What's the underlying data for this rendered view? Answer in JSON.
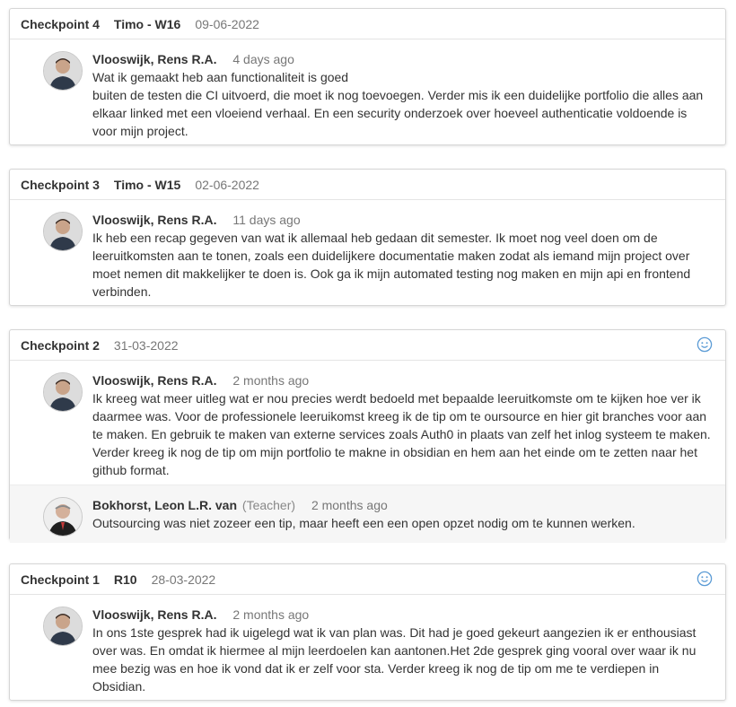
{
  "checkpoints": [
    {
      "title": "Checkpoint 4",
      "subtitle": "Timo - W16",
      "date": "09-06-2022",
      "smiley": false,
      "comments": [
        {
          "author": "Vlooswijk, Rens R.A.",
          "role": "",
          "time": "4 days ago",
          "text": "Wat ik gemaakt heb aan functionaliteit is goed\nbuiten de testen die CI uitvoerd, die moet ik nog toevoegen. Verder mis ik een duidelijke portfolio die alles aan elkaar linked met een vloeiend verhaal. En een security onderzoek over hoeveel authenticatie voldoende is voor mijn project."
        }
      ]
    },
    {
      "title": "Checkpoint 3",
      "subtitle": "Timo - W15",
      "date": "02-06-2022",
      "smiley": false,
      "comments": [
        {
          "author": "Vlooswijk, Rens R.A.",
          "role": "",
          "time": "11 days ago",
          "text": "Ik heb een recap gegeven van wat ik allemaal heb gedaan dit semester. Ik moet nog veel doen om de leeruitkomsten aan te tonen, zoals een duidelijkere documentatie maken zodat als iemand mijn project over moet nemen dit makkelijker te doen is. Ook ga ik mijn automated testing nog maken en mijn api en frontend verbinden."
        }
      ]
    },
    {
      "title": "Checkpoint 2",
      "subtitle": "",
      "date": "31-03-2022",
      "smiley": true,
      "comments": [
        {
          "author": "Vlooswijk, Rens R.A.",
          "role": "",
          "time": "2 months ago",
          "text": "Ik kreeg wat meer uitleg wat er nou precies werdt bedoeld met bepaalde leeruitkomste om te kijken hoe ver ik daarmee was. Voor de professionele leeruikomst kreeg ik de tip om te oursource en hier git branches voor aan te maken. En gebruik te maken van externe services zoals Auth0 in plaats van zelf het inlog systeem te maken. Verder kreeg ik nog de tip om mijn portfolio te makne in obsidian en hem aan het einde om te zetten naar het github format."
        },
        {
          "author": "Bokhorst, Leon L.R. van",
          "role": "(Teacher)",
          "time": "2 months ago",
          "text": "Outsourcing was niet zozeer een tip, maar heeft een een open opzet nodig om te kunnen werken."
        }
      ]
    },
    {
      "title": "Checkpoint 1",
      "subtitle": "R10",
      "date": "28-03-2022",
      "smiley": true,
      "comments": [
        {
          "author": "Vlooswijk, Rens R.A.",
          "role": "",
          "time": "2 months ago",
          "text": "In ons 1ste gesprek had ik uigelegd wat ik van plan was. Dit had je goed gekeurt aangezien ik er enthousiast over was. En omdat ik hiermee al mijn leerdoelen kan aantonen.Het 2de gesprek ging vooral over waar ik nu mee bezig was en hoe ik vond dat ik er zelf voor sta. Verder kreeg ik nog de tip om me te verdiepen in Obsidian."
        }
      ]
    }
  ],
  "colors": {
    "smiley": "#5b9bd5",
    "border": "#d6d6d6"
  },
  "icons": {
    "smiley": "smiley-icon",
    "student_avatar": "avatar",
    "teacher_avatar": "avatar"
  }
}
